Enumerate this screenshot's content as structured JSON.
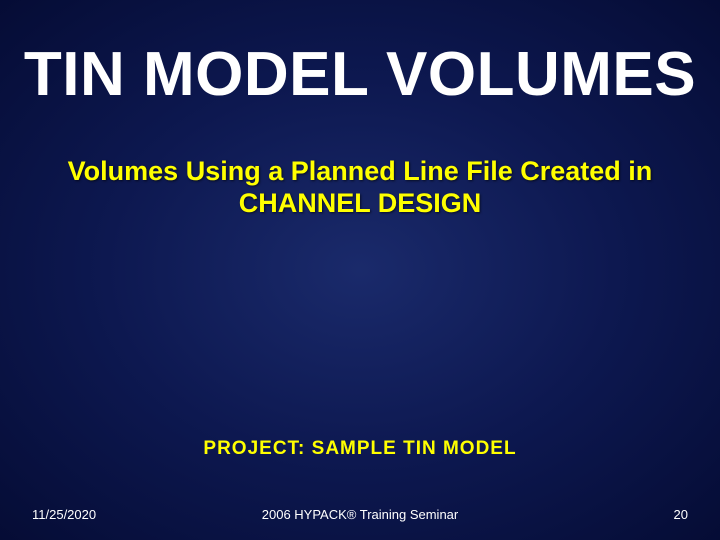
{
  "slide": {
    "title": "TIN MODEL VOLUMES",
    "subtitle": "Volumes Using a Planned Line File Created in CHANNEL DESIGN",
    "project_label": "PROJECT:  SAMPLE TIN MODEL"
  },
  "footer": {
    "date": "11/25/2020",
    "center": "2006 HYPACK® Training Seminar",
    "page": "20"
  }
}
